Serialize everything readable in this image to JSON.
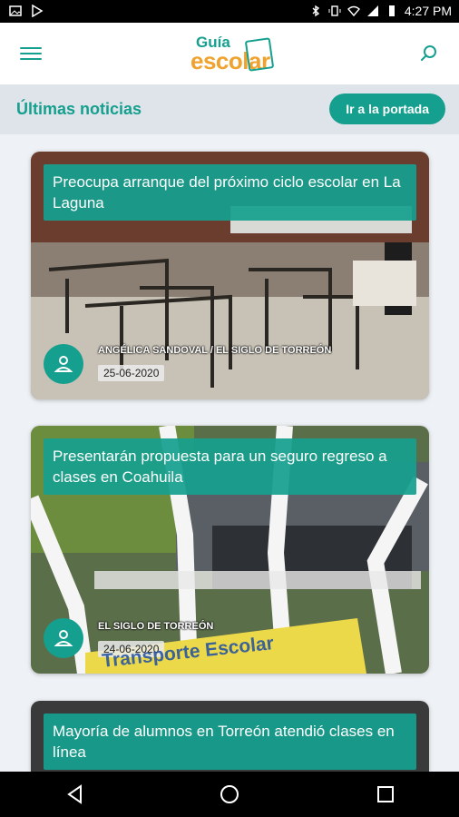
{
  "status_bar": {
    "time": "4:27 PM",
    "icons": [
      "image-icon",
      "play-store-icon",
      "bluetooth-icon",
      "vibrate-icon",
      "wifi-icon",
      "signal-icon",
      "battery-icon"
    ]
  },
  "app_bar": {
    "logo_top": "Guía",
    "logo_main": "escolar",
    "menu_icon": "hamburger-menu-icon",
    "search_icon": "search-icon"
  },
  "section": {
    "title": "Últimas noticias",
    "button_label": "Ir a la portada"
  },
  "articles": [
    {
      "title": "Preocupa arranque del próximo ciclo escolar en La Laguna",
      "author": "ANGÉLICA SANDOVAL / EL SIGLO DE TORREÓN",
      "date": "25-06-2020"
    },
    {
      "title": "Presentarán propuesta para un seguro regreso a clases en Coahuila",
      "author": "EL SIGLO DE TORREÓN",
      "date": "24-06-2020",
      "sign_text": "Transporte Escolar"
    },
    {
      "title": "Mayoría de alumnos en Torreón atendió clases en línea"
    }
  ],
  "colors": {
    "accent": "#159f8e",
    "logo_orange": "#f0a22e",
    "section_bg": "#dfe4ea"
  }
}
